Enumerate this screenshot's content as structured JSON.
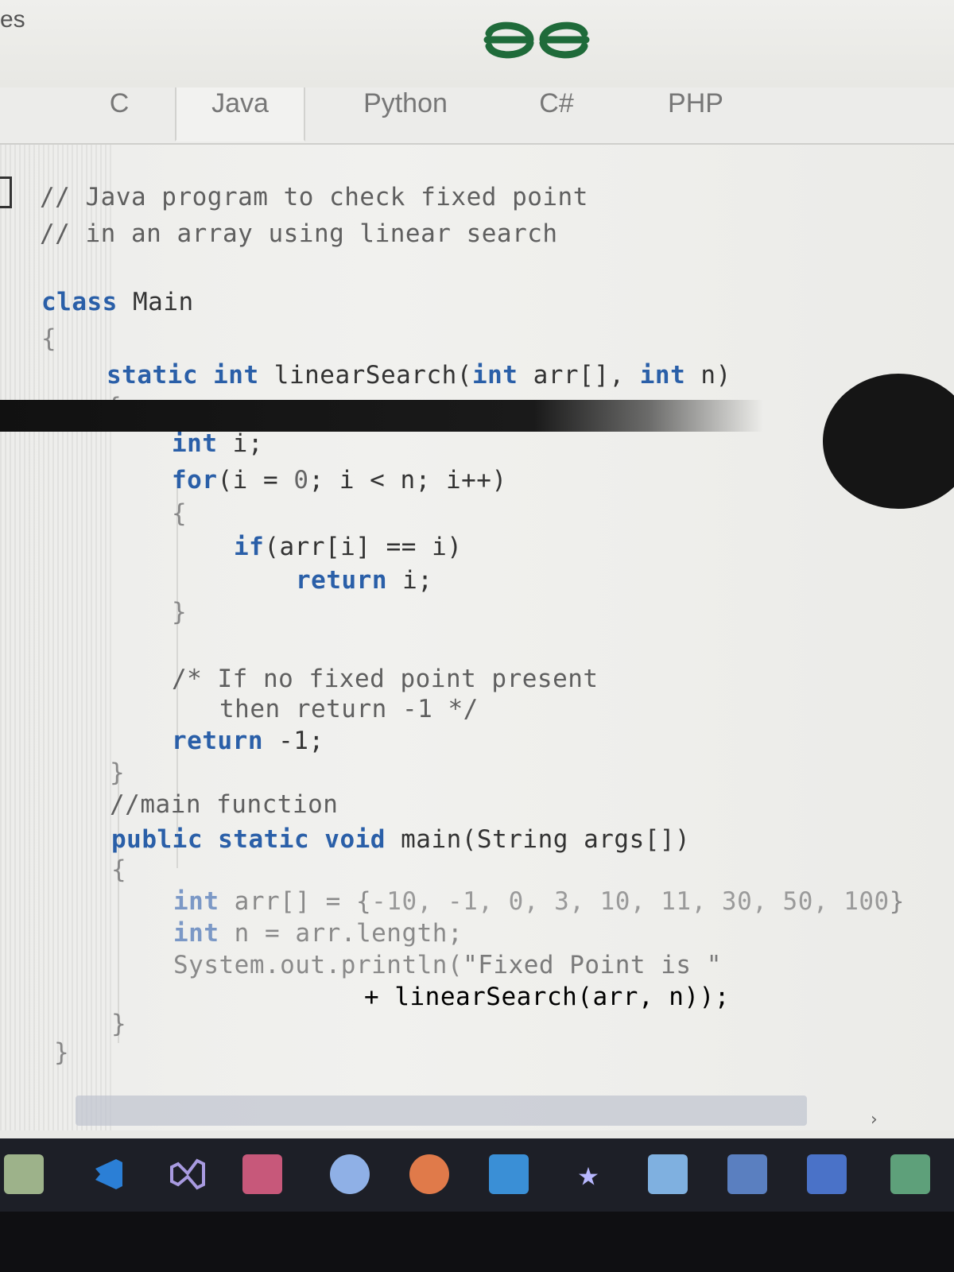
{
  "app": {
    "top_left_text": "es",
    "logo_text": "ƏG"
  },
  "tabs": [
    {
      "label": "C"
    },
    {
      "label": "Java"
    },
    {
      "label": "Python"
    },
    {
      "label": "C#"
    },
    {
      "label": "PHP"
    }
  ],
  "code_lines": [
    "// Java program to check fixed point",
    "// in an array using linear search",
    "class Main",
    "{",
    "static int linearSearch(int arr[], int n)",
    "{",
    "int i;",
    "for(i = 0; i < n; i++)",
    "{",
    "if(arr[i] == i)",
    "return i;",
    "}",
    "/* If no fixed point present",
    "then return -1 */",
    "return -1;",
    "}",
    "//main function",
    "public static void main(String args[])",
    "{",
    "int arr[] = {-10, -1, 0, 3, 10, 11, 30, 50, 100}",
    "int n = arr.length;",
    "System.out.println(\"Fixed Point is \"",
    "+ linearSearch(arr, n));",
    "}",
    "}"
  ],
  "taskbar": {
    "icons": [
      "notepad-icon",
      "vscode-icon",
      "visual-studio-icon",
      "access-icon",
      "chrome-icon",
      "firefox-icon",
      "refresh-app-icon",
      "star-icon",
      "publisher-icon",
      "app-window-icon",
      "word-icon",
      "excel-icon"
    ]
  },
  "colors": {
    "keyword": "#2a5fa8",
    "logo": "#1f6b3a",
    "taskbar": "#1d1f27"
  }
}
